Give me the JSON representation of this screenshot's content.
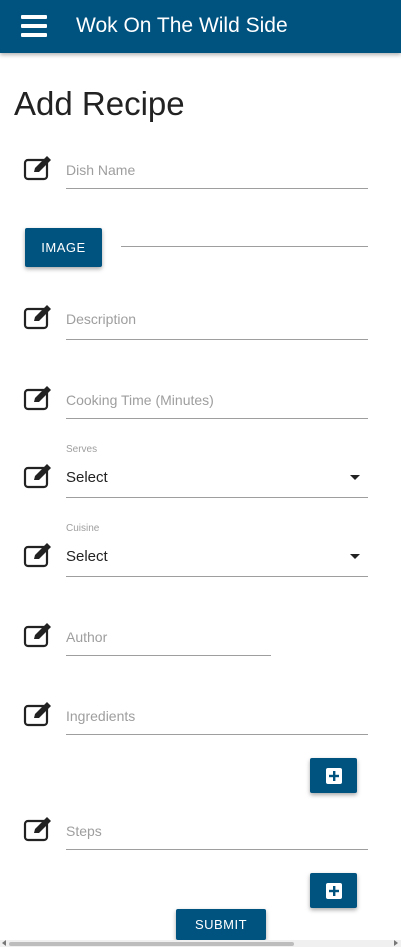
{
  "app": {
    "brand": "Wok On The Wild Side"
  },
  "page": {
    "title": "Add Recipe"
  },
  "form": {
    "dish_name": {
      "placeholder": "Dish Name"
    },
    "image_button": "IMAGE",
    "description": {
      "placeholder": "Description"
    },
    "cooking_time": {
      "placeholder": "Cooking Time (Minutes)"
    },
    "serves": {
      "label": "Serves",
      "value": "Select"
    },
    "cuisine": {
      "label": "Cuisine",
      "value": "Select"
    },
    "author": {
      "placeholder": "Author"
    },
    "ingredients": {
      "placeholder": "Ingredients"
    },
    "steps": {
      "placeholder": "Steps"
    },
    "submit_button": "SUBMIT"
  },
  "icons": {
    "menu": "hamburger-menu-icon",
    "field": "edit-icon",
    "add": "plus-square-icon"
  },
  "colors": {
    "primary": "#00527f",
    "line": "#9e9e9e",
    "text": "#222222"
  }
}
